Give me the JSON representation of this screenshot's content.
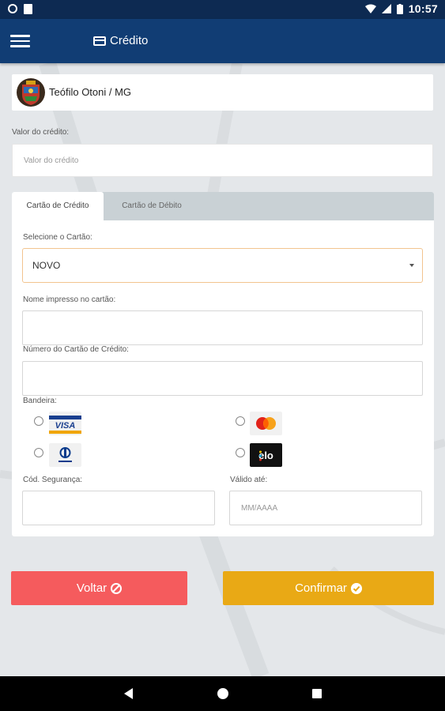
{
  "status_bar": {
    "time": "10:57"
  },
  "app_bar": {
    "title": "Crédito",
    "menu_icon": "menu-icon",
    "title_icon": "credit-card-icon"
  },
  "city": {
    "name": "Teófilo Otoni / MG",
    "crest_icon": "city-crest-icon"
  },
  "valor": {
    "label": "Valor do crédito:",
    "placeholder": "Valor do crédito",
    "value": ""
  },
  "tabs": [
    {
      "label": "Cartão de Crédito",
      "active": true
    },
    {
      "label": "Cartão de Débito",
      "active": false
    }
  ],
  "form": {
    "select_label": "Selecione o Cartão:",
    "select_value": "NOVO",
    "name_label": "Nome impresso no cartão:",
    "name_value": "",
    "number_label": "Número do Cartão de Crédito:",
    "number_value": "",
    "brand_label": "Bandeira:",
    "brands": [
      {
        "name": "VISA",
        "icon": "visa-logo"
      },
      {
        "name": "Mastercard",
        "icon": "mastercard-logo"
      },
      {
        "name": "Diners Club",
        "icon": "diners-logo"
      },
      {
        "name": "elo",
        "icon": "elo-logo"
      }
    ],
    "cvv_label": "Cód. Segurança:",
    "cvv_value": "",
    "expiry_label": "Válido até:",
    "expiry_placeholder": "MM/AAAA"
  },
  "buttons": {
    "back": "Voltar",
    "confirm": "Confirmar"
  },
  "colors": {
    "app_bar": "#113d74",
    "status_bar": "#0d2a52",
    "back_button": "#f55b5d",
    "confirm_button": "#e9a915",
    "select_border": "#f2c48f"
  }
}
